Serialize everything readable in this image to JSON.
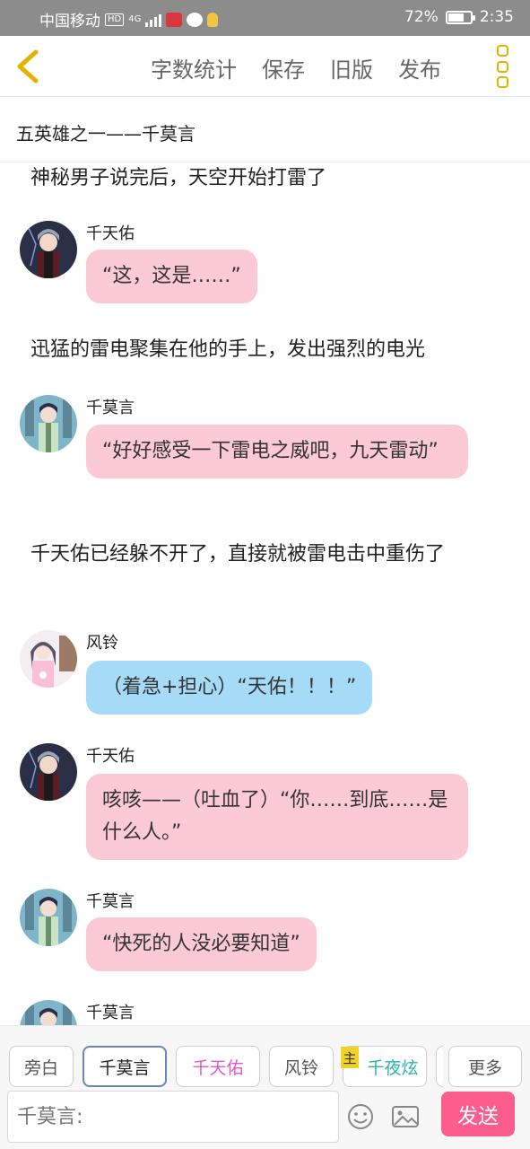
{
  "status_bar": {
    "carrier": "中国移动",
    "hd": "HD",
    "network": "4G",
    "battery_percent": "72%",
    "battery_level": 0.72,
    "time": "2:35",
    "app_icon_colors": [
      "#d9363e",
      "#ffffff",
      "#f4c542"
    ]
  },
  "toolbar": {
    "back_icon": "chevron-left-icon",
    "accent_color": "#e0b400",
    "actions": [
      {
        "label": "字数统计"
      },
      {
        "label": "保存"
      },
      {
        "label": "旧版"
      },
      {
        "label": "发布"
      }
    ],
    "more_icon": "more-vertical-icon"
  },
  "story_title": "五英雄之一——千莫言",
  "messages": [
    {
      "type": "narration",
      "text": "神秘男子说完后，天空开始打雷了"
    },
    {
      "type": "dialogue",
      "speaker": "千天佑",
      "bubble": "pink",
      "text": "“这，这是……”"
    },
    {
      "type": "narration",
      "text": "迅猛的雷电聚集在他的手上，发出强烈的电光"
    },
    {
      "type": "dialogue",
      "speaker": "千莫言",
      "bubble": "pink",
      "text": "“好好感受一下雷电之威吧，九天雷动”"
    },
    {
      "type": "narration",
      "text": "千天佑已经躲不开了，直接就被雷电击中重伤了"
    },
    {
      "type": "dialogue",
      "speaker": "风铃",
      "bubble": "blue",
      "text": "（着急+担心）“天佑！！！”"
    },
    {
      "type": "dialogue",
      "speaker": "千天佑",
      "bubble": "pink",
      "text": "咳咳——（吐血了）“你……到底……是什么人。”"
    },
    {
      "type": "dialogue",
      "speaker": "千莫言",
      "bubble": "pink",
      "text": "“快死的人没必要知道”"
    },
    {
      "type": "dialogue",
      "speaker": "千莫言",
      "bubble": "pink",
      "text": ""
    }
  ],
  "colors": {
    "bubble_pink": "#fbcad5",
    "bubble_blue": "#a6dbf8",
    "send_button": "#fd5d8d"
  },
  "characters": [
    {
      "name": "旁白"
    },
    {
      "name": "千莫言",
      "selected": true
    },
    {
      "name": "千天佑"
    },
    {
      "name": "风铃"
    },
    {
      "name": "千夜炫",
      "badge": "主"
    }
  ],
  "more_label": "更多",
  "input": {
    "placeholder": "千莫言:",
    "emoji_icon": "smiley-icon",
    "image_icon": "image-icon"
  },
  "send_label": "发送"
}
